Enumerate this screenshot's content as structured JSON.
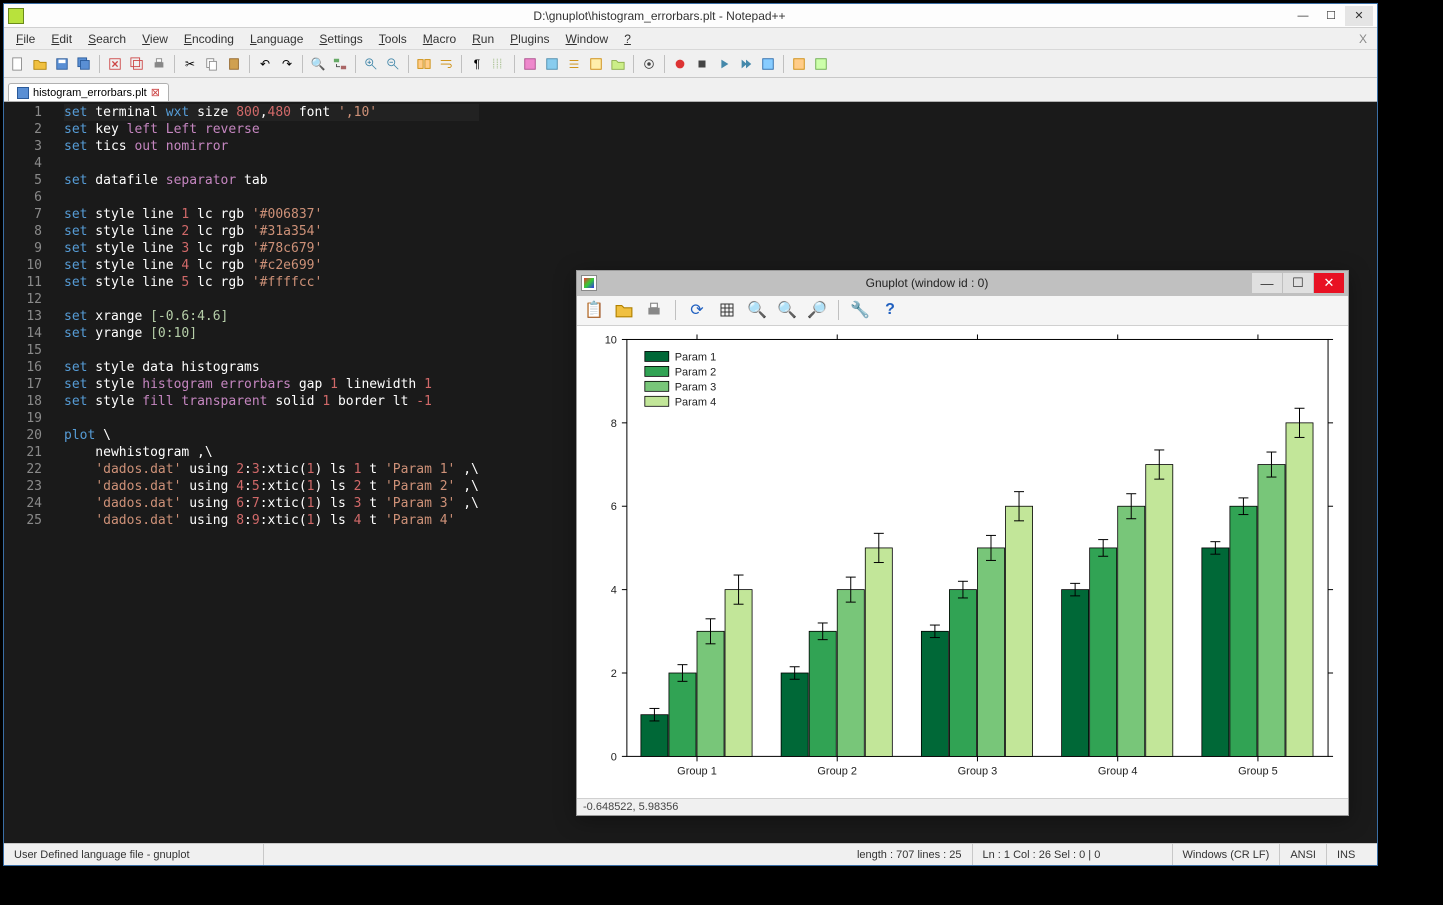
{
  "npp": {
    "title": "D:\\gnuplot\\histogram_errorbars.plt - Notepad++",
    "menus": [
      "File",
      "Edit",
      "Search",
      "View",
      "Encoding",
      "Language",
      "Settings",
      "Tools",
      "Macro",
      "Run",
      "Plugins",
      "Window",
      "?"
    ],
    "tab_label": "histogram_errorbars.plt",
    "status": {
      "lang": "User Defined language file - gnuplot",
      "length": "length : 707    lines : 25",
      "pos": "Ln : 1   Col : 26   Sel : 0 | 0",
      "eol": "Windows (CR LF)",
      "enc": "ANSI",
      "mode": "INS"
    }
  },
  "gp": {
    "title": "Gnuplot (window id : 0)",
    "status": "-0.648522, 5.98356"
  },
  "chart_data": {
    "type": "bar",
    "title": "",
    "categories": [
      "Group 1",
      "Group 2",
      "Group 3",
      "Group 4",
      "Group 5"
    ],
    "series": [
      {
        "name": "Param 1",
        "color": "#006837",
        "values": [
          1,
          2,
          3,
          4,
          5
        ],
        "errors": [
          0.15,
          0.15,
          0.15,
          0.15,
          0.15
        ]
      },
      {
        "name": "Param 2",
        "color": "#31a354",
        "values": [
          2,
          3,
          4,
          5,
          6
        ],
        "errors": [
          0.2,
          0.2,
          0.2,
          0.2,
          0.2
        ]
      },
      {
        "name": "Param 3",
        "color": "#78c679",
        "values": [
          3,
          4,
          5,
          6,
          7
        ],
        "errors": [
          0.3,
          0.3,
          0.3,
          0.3,
          0.3
        ]
      },
      {
        "name": "Param 4",
        "color": "#c2e699",
        "values": [
          4,
          5,
          6,
          7,
          8
        ],
        "errors": [
          0.35,
          0.35,
          0.35,
          0.35,
          0.35
        ]
      }
    ],
    "xlabel": "",
    "ylabel": "",
    "xlim": [
      -0.6,
      4.6
    ],
    "ylim": [
      0,
      10
    ],
    "yticks": [
      0,
      2,
      4,
      6,
      8,
      10
    ],
    "legend_position": "upper-left",
    "grid": false
  },
  "code_lines": [
    [
      [
        "kw",
        "set"
      ],
      [
        "white",
        " terminal "
      ],
      [
        "kw",
        "wxt"
      ],
      [
        "white",
        " size "
      ],
      [
        "red",
        "800"
      ],
      [
        "white",
        ","
      ],
      [
        "red",
        "480"
      ],
      [
        "white",
        " font "
      ],
      [
        "str",
        "',10'"
      ]
    ],
    [
      [
        "kw",
        "set"
      ],
      [
        "white",
        " key "
      ],
      [
        "opt",
        "left Left reverse"
      ]
    ],
    [
      [
        "kw",
        "set"
      ],
      [
        "white",
        " tics "
      ],
      [
        "opt",
        "out nomirror"
      ]
    ],
    [],
    [
      [
        "kw",
        "set"
      ],
      [
        "white",
        " datafile "
      ],
      [
        "opt",
        "separator"
      ],
      [
        "white",
        " tab"
      ]
    ],
    [],
    [
      [
        "kw",
        "set"
      ],
      [
        "white",
        " style line "
      ],
      [
        "red",
        "1"
      ],
      [
        "white",
        " lc rgb "
      ],
      [
        "str",
        "'#006837'"
      ]
    ],
    [
      [
        "kw",
        "set"
      ],
      [
        "white",
        " style line "
      ],
      [
        "red",
        "2"
      ],
      [
        "white",
        " lc rgb "
      ],
      [
        "str",
        "'#31a354'"
      ]
    ],
    [
      [
        "kw",
        "set"
      ],
      [
        "white",
        " style line "
      ],
      [
        "red",
        "3"
      ],
      [
        "white",
        " lc rgb "
      ],
      [
        "str",
        "'#78c679'"
      ]
    ],
    [
      [
        "kw",
        "set"
      ],
      [
        "white",
        " style line "
      ],
      [
        "red",
        "4"
      ],
      [
        "white",
        " lc rgb "
      ],
      [
        "str",
        "'#c2e699'"
      ]
    ],
    [
      [
        "kw",
        "set"
      ],
      [
        "white",
        " style line "
      ],
      [
        "red",
        "5"
      ],
      [
        "white",
        " lc rgb "
      ],
      [
        "str",
        "'#ffffcc'"
      ]
    ],
    [],
    [
      [
        "kw",
        "set"
      ],
      [
        "white",
        " xrange "
      ],
      [
        "num",
        "[-0.6:4.6]"
      ]
    ],
    [
      [
        "kw",
        "set"
      ],
      [
        "white",
        " yrange "
      ],
      [
        "num",
        "[0:10]"
      ]
    ],
    [],
    [
      [
        "kw",
        "set"
      ],
      [
        "white",
        " style data "
      ],
      [
        "white",
        "histograms"
      ]
    ],
    [
      [
        "kw",
        "set"
      ],
      [
        "white",
        " style "
      ],
      [
        "opt",
        "histogram errorbars"
      ],
      [
        "white",
        " gap "
      ],
      [
        "red",
        "1"
      ],
      [
        "white",
        " linewidth "
      ],
      [
        "red",
        "1"
      ]
    ],
    [
      [
        "kw",
        "set"
      ],
      [
        "white",
        " style "
      ],
      [
        "opt",
        "fill transparent"
      ],
      [
        "white",
        " solid "
      ],
      [
        "red",
        "1"
      ],
      [
        "white",
        " border lt "
      ],
      [
        "red",
        "-1"
      ]
    ],
    [],
    [
      [
        "kw",
        "plot"
      ],
      [
        "white",
        " \\"
      ]
    ],
    [
      [
        "white",
        "    newhistogram ,\\"
      ]
    ],
    [
      [
        "white",
        "    "
      ],
      [
        "str",
        "'dados.dat'"
      ],
      [
        "white",
        " using "
      ],
      [
        "red",
        "2"
      ],
      [
        "white",
        ":"
      ],
      [
        "red",
        "3"
      ],
      [
        "white",
        ":xtic("
      ],
      [
        "red",
        "1"
      ],
      [
        "white",
        ") ls "
      ],
      [
        "red",
        "1"
      ],
      [
        "white",
        " t "
      ],
      [
        "str",
        "'Param 1'"
      ],
      [
        "white",
        " ,\\"
      ]
    ],
    [
      [
        "white",
        "    "
      ],
      [
        "str",
        "'dados.dat'"
      ],
      [
        "white",
        " using "
      ],
      [
        "red",
        "4"
      ],
      [
        "white",
        ":"
      ],
      [
        "red",
        "5"
      ],
      [
        "white",
        ":xtic("
      ],
      [
        "red",
        "1"
      ],
      [
        "white",
        ") ls "
      ],
      [
        "red",
        "2"
      ],
      [
        "white",
        " t "
      ],
      [
        "str",
        "'Param 2'"
      ],
      [
        "white",
        " ,\\"
      ]
    ],
    [
      [
        "white",
        "    "
      ],
      [
        "str",
        "'dados.dat'"
      ],
      [
        "white",
        " using "
      ],
      [
        "red",
        "6"
      ],
      [
        "white",
        ":"
      ],
      [
        "red",
        "7"
      ],
      [
        "white",
        ":xtic("
      ],
      [
        "red",
        "1"
      ],
      [
        "white",
        ") ls "
      ],
      [
        "red",
        "3"
      ],
      [
        "white",
        " t "
      ],
      [
        "str",
        "'Param 3'"
      ],
      [
        "white",
        " ,\\"
      ]
    ],
    [
      [
        "white",
        "    "
      ],
      [
        "str",
        "'dados.dat'"
      ],
      [
        "white",
        " using "
      ],
      [
        "red",
        "8"
      ],
      [
        "white",
        ":"
      ],
      [
        "red",
        "9"
      ],
      [
        "white",
        ":xtic("
      ],
      [
        "red",
        "1"
      ],
      [
        "white",
        ") ls "
      ],
      [
        "red",
        "4"
      ],
      [
        "white",
        " t "
      ],
      [
        "str",
        "'Param 4'"
      ]
    ]
  ]
}
